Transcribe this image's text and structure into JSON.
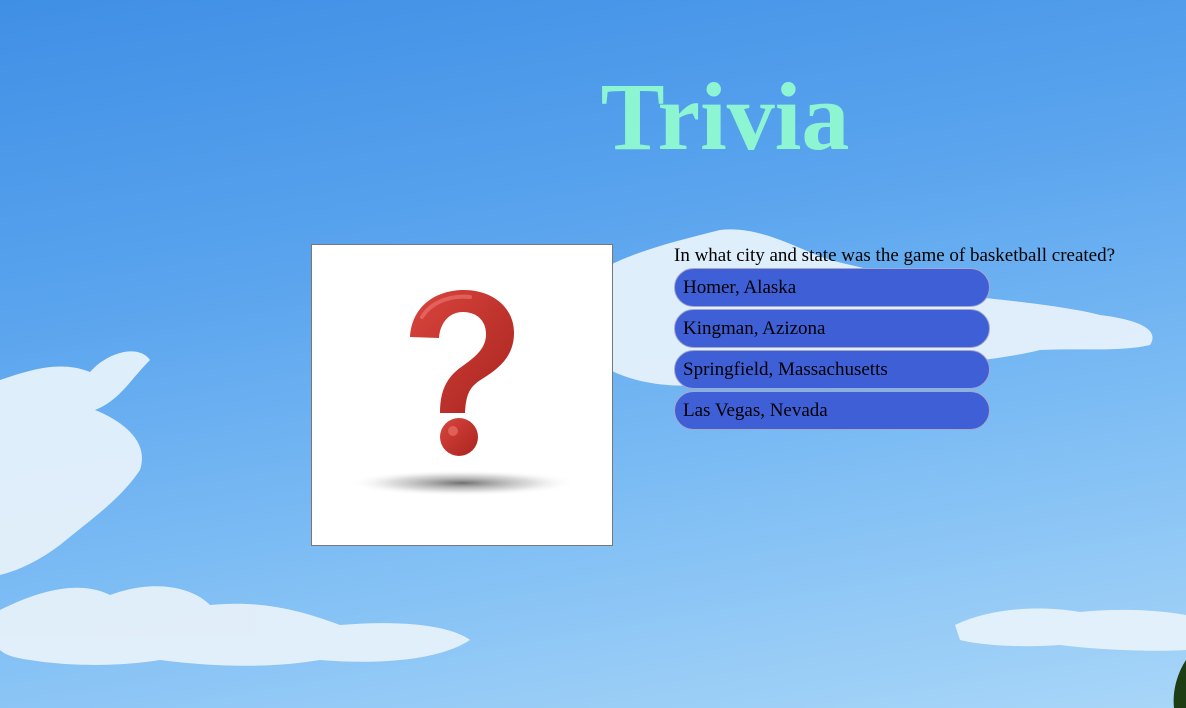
{
  "page": {
    "title": "Trivia"
  },
  "question": {
    "text": "In what city and state was the game of basketball created?",
    "image_icon": "question-mark-icon"
  },
  "answers": [
    {
      "label": "Homer, Alaska"
    },
    {
      "label": "Kingman, Azizona"
    },
    {
      "label": "Springfield, Massachusetts"
    },
    {
      "label": "Las Vegas, Nevada"
    }
  ],
  "colors": {
    "title": "#8ef5d2",
    "answer_button": "#3f5fd6",
    "question_mark": "#c0302a",
    "sky": "#5aa4ee"
  }
}
